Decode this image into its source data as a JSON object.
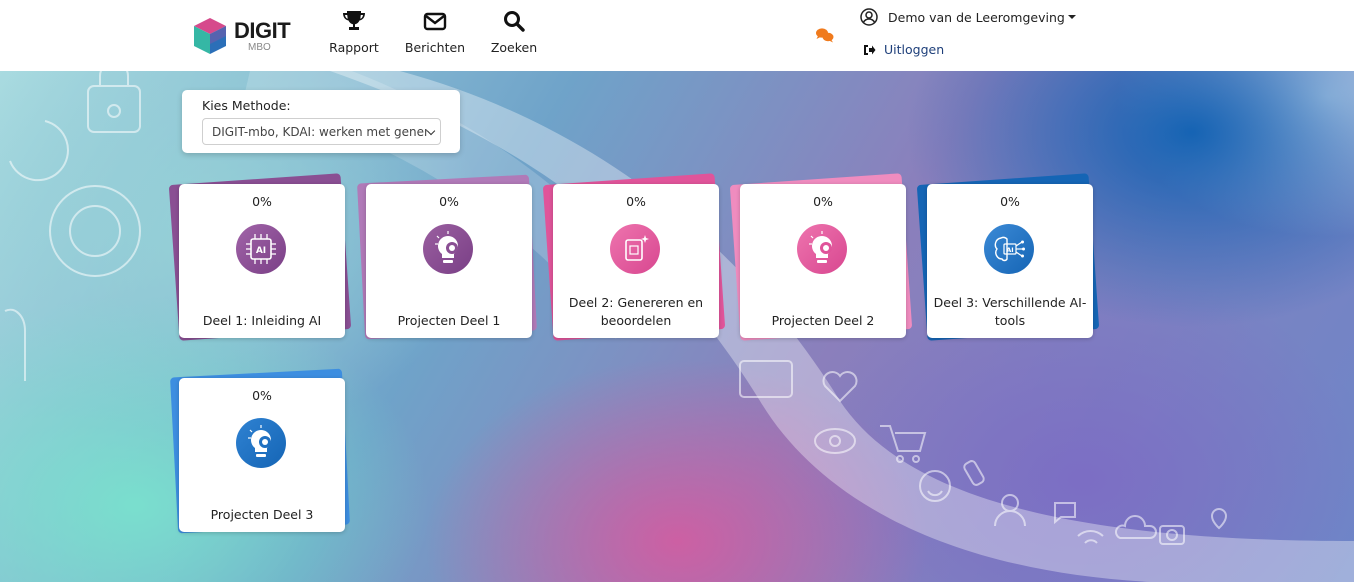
{
  "brand": {
    "name": "DIGIT",
    "sub": "MBO"
  },
  "nav": [
    {
      "label": "Rapport",
      "icon": "trophy-icon"
    },
    {
      "label": "Berichten",
      "icon": "envelope-icon"
    },
    {
      "label": "Zoeken",
      "icon": "search-icon"
    }
  ],
  "user": {
    "name": "Demo van de Leeromgeving",
    "logout_label": "Uitloggen"
  },
  "method": {
    "label": "Kies Methode:",
    "selected": "DIGIT-mbo, KDAI: werken met generatieve AI"
  },
  "colors": {
    "purple": "#8a4f93",
    "mauve": "#9a5fa0",
    "pink": "#e0549a",
    "pink_light": "#e06aa6",
    "blue": "#1f70c1",
    "blue_dark": "#1565b5"
  },
  "modules": [
    {
      "progress": "0%",
      "title": "Deel 1: Inleiding AI",
      "icon": "ai-chip-icon"
    },
    {
      "progress": "0%",
      "title": "Projecten Deel 1",
      "icon": "lightbulb-gear-icon"
    },
    {
      "progress": "0%",
      "title": "Deel 2: Genereren en beoordelen",
      "icon": "ai-document-icon"
    },
    {
      "progress": "0%",
      "title": "Projecten Deel 2",
      "icon": "lightbulb-gear-icon"
    },
    {
      "progress": "0%",
      "title": "Deel 3: Verschillende AI-tools",
      "icon": "ai-brain-icon"
    },
    {
      "progress": "0%",
      "title": "Projecten Deel 3",
      "icon": "lightbulb-gear-icon"
    }
  ]
}
